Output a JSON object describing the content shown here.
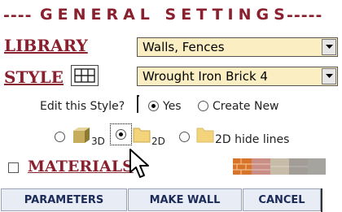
{
  "header": {
    "left_dashes": "----",
    "title": "GENERAL SETTINGS",
    "right_dashes": "-----"
  },
  "library": {
    "label": "LIBRARY",
    "value": "Walls, Fences"
  },
  "style": {
    "label": "STYLE",
    "value": "Wrought Iron Brick 4"
  },
  "edit_style": {
    "prompt": "Edit this Style?",
    "options": [
      "Yes",
      "Create New"
    ],
    "selected": "Yes"
  },
  "view_mode": {
    "options": [
      {
        "label": "3D",
        "icon": "cube-3d-icon"
      },
      {
        "label": "2D",
        "icon": "folder-2d-icon"
      },
      {
        "label": "2D hide lines",
        "icon": "folder-2d-icon"
      }
    ],
    "selected": "2D"
  },
  "materials": {
    "label": "MATERIALS",
    "checked": false,
    "swatch_colors": [
      "#d8742a",
      "#c98f86",
      "#c7bca8",
      "#a39d97",
      "#a6a49e"
    ]
  },
  "buttons": {
    "parameters": "PARAMETERS",
    "make_wall": "MAKE WALL",
    "cancel": "CANCEL"
  },
  "colors": {
    "accent": "#8a1f2d",
    "dropdown_bg": "#fbeec2",
    "button_text": "#1c2a58"
  }
}
